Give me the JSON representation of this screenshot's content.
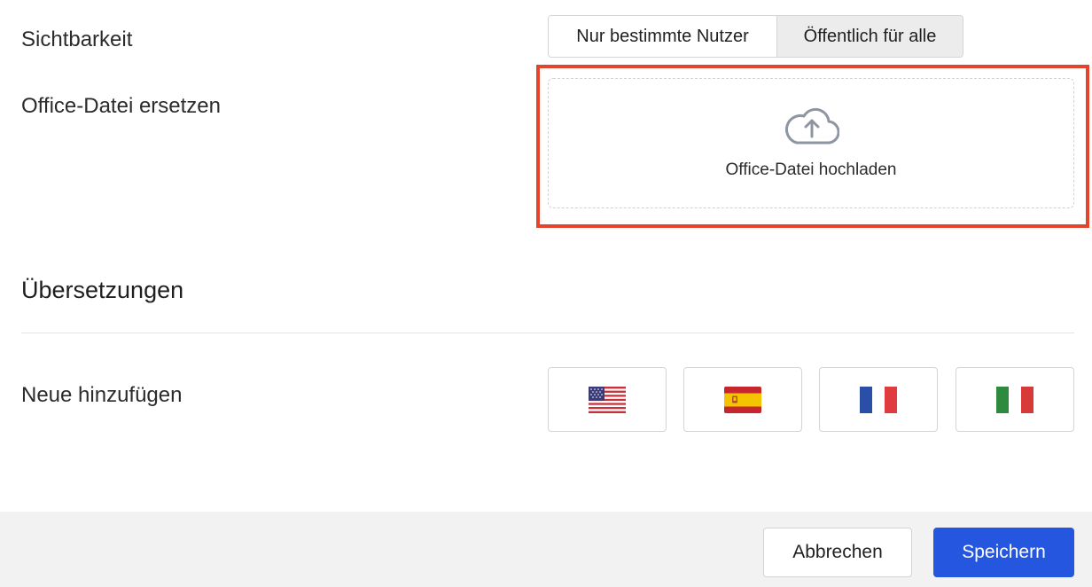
{
  "visibility": {
    "label": "Sichtbarkeit",
    "options": [
      "Nur bestimmte Nutzer",
      "Öffentlich für alle"
    ],
    "selected": "Öffentlich für alle"
  },
  "replace_file": {
    "label": "Office-Datei ersetzen",
    "upload_label": "Office-Datei hochladen",
    "icon": "cloud-upload-icon"
  },
  "translations": {
    "title": "Übersetzungen",
    "add_label": "Neue hinzufügen",
    "languages": [
      {
        "flag": "us-flag-icon"
      },
      {
        "flag": "es-flag-icon"
      },
      {
        "flag": "fr-flag-icon"
      },
      {
        "flag": "it-flag-icon"
      }
    ]
  },
  "footer": {
    "cancel_label": "Abbrechen",
    "save_label": "Speichern"
  },
  "colors": {
    "highlight": "#e2452c",
    "primary": "#2456e0",
    "segment_active": "#ececec"
  }
}
